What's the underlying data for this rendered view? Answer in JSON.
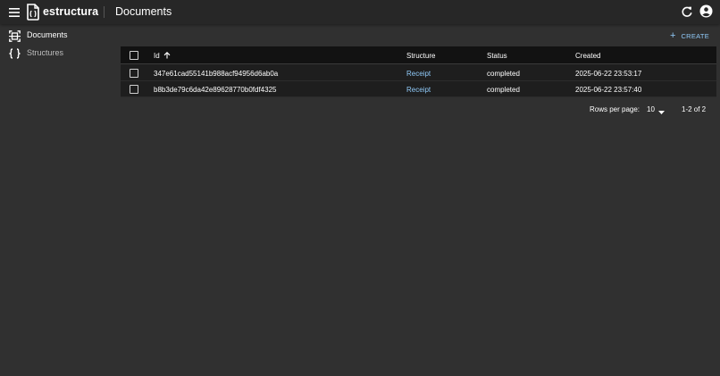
{
  "app": {
    "brand": "estructura",
    "page_title": "Documents"
  },
  "icons": {
    "menu": "menu-icon",
    "logo": "file-braces-icon",
    "refresh": "refresh-icon",
    "account": "account-circle-icon",
    "documents": "document-scanner-icon",
    "structures": "braces-icon",
    "create": "plus-icon",
    "sort": "arrow-up-icon",
    "select_arrow": "caret-down-icon"
  },
  "sidebar": {
    "items": [
      {
        "label": "Documents"
      },
      {
        "label": "Structures"
      }
    ]
  },
  "toolbar": {
    "create_label": "CREATE"
  },
  "table": {
    "columns": [
      "Id",
      "Structure",
      "Status",
      "Created"
    ],
    "rows": [
      {
        "id": "347e61cad55141b988acf94956d6ab0a",
        "structure": "Receipt",
        "status": "completed",
        "created": "2025-06-22 23:53:17"
      },
      {
        "id": "b8b3de79c6da42e89628770b0fdf4325",
        "structure": "Receipt",
        "status": "completed",
        "created": "2025-06-22 23:57:40"
      }
    ]
  },
  "pagination": {
    "rows_per_page_label": "Rows per page:",
    "rows_per_page_value": "10",
    "range": "1-2 of 2"
  },
  "colors": {
    "background": "#303030",
    "appbar": "#272727",
    "table_header": "#121212",
    "table_row": "#1e1e1e",
    "link": "#90caf9"
  }
}
